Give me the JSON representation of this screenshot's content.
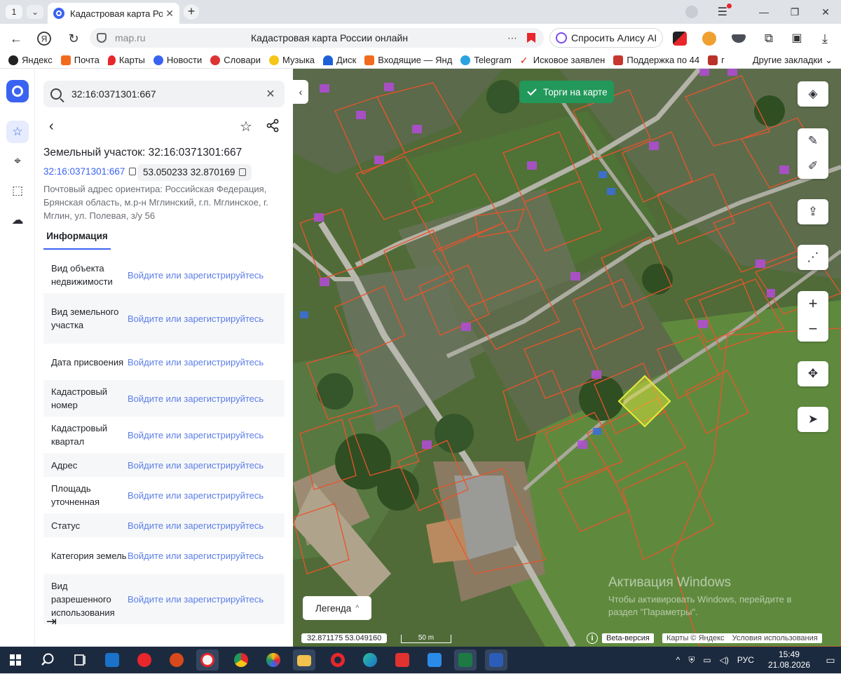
{
  "browser": {
    "tab_count": "1",
    "active_tab_title": "Кадастровая карта Рос",
    "url_host": "map.ru",
    "page_title": "Кадастровая карта России онлайн",
    "alice_label": "Спросить Алису AI",
    "bookmarks": [
      "Яндекс",
      "Почта",
      "Карты",
      "Новости",
      "Словари",
      "Музыка",
      "Диск",
      "Входящие — Янд",
      "Telegram",
      "Исковое заявлен",
      "Поддержка по 44",
      "г"
    ],
    "other_bookmarks": "Другие закладки"
  },
  "panel": {
    "search_value": "32:16:0371301:667",
    "heading": "Земельный участок: 32:16:0371301:667",
    "cad_link": "32:16:0371301:667",
    "coords": "53.050233 32.870169",
    "address": "Почтовый адрес ориентира: Российская Федерация, Брянская область, м.р-н Мглинский, г.п. Мглинское, г. Мглин, ул. Полевая, з/у 56",
    "tab_info": "Информация",
    "login_text": "Войдите или зарегистрируйтесь",
    "rows": [
      {
        "label": "Вид объекта недвижимости"
      },
      {
        "label": "Вид земельного участка"
      },
      {
        "label": "Дата присвоения"
      },
      {
        "label": "Кадастровый номер"
      },
      {
        "label": "Кадастровый квартал"
      },
      {
        "label": "Адрес"
      },
      {
        "label": "Площадь уточненная"
      },
      {
        "label": "Статус"
      },
      {
        "label": "Категория земель"
      },
      {
        "label": "Вид разрешенного использования"
      }
    ]
  },
  "map": {
    "torgi_label": "Торги на карте",
    "legend_label": "Легенда",
    "coord_readout": "32.871175   53.049160",
    "scale_label": "50 m",
    "beta_label": "Beta-версия",
    "attribution": "Карты © Яндекс",
    "terms": "Условия использования",
    "win_activate_title": "Активация Windows",
    "win_activate_text": "Чтобы активировать Windows, перейдите в раздел \"Параметры\".",
    "colors": {
      "parcel_border": "#e8542c",
      "selected_parcel": "#e6ee3a",
      "building_fill": "#b44bd8",
      "accent": "#3a63f2",
      "torgi_green": "#22985a"
    }
  },
  "taskbar": {
    "lang": "РУС",
    "time": "15:49",
    "date": "21.08.2026"
  }
}
